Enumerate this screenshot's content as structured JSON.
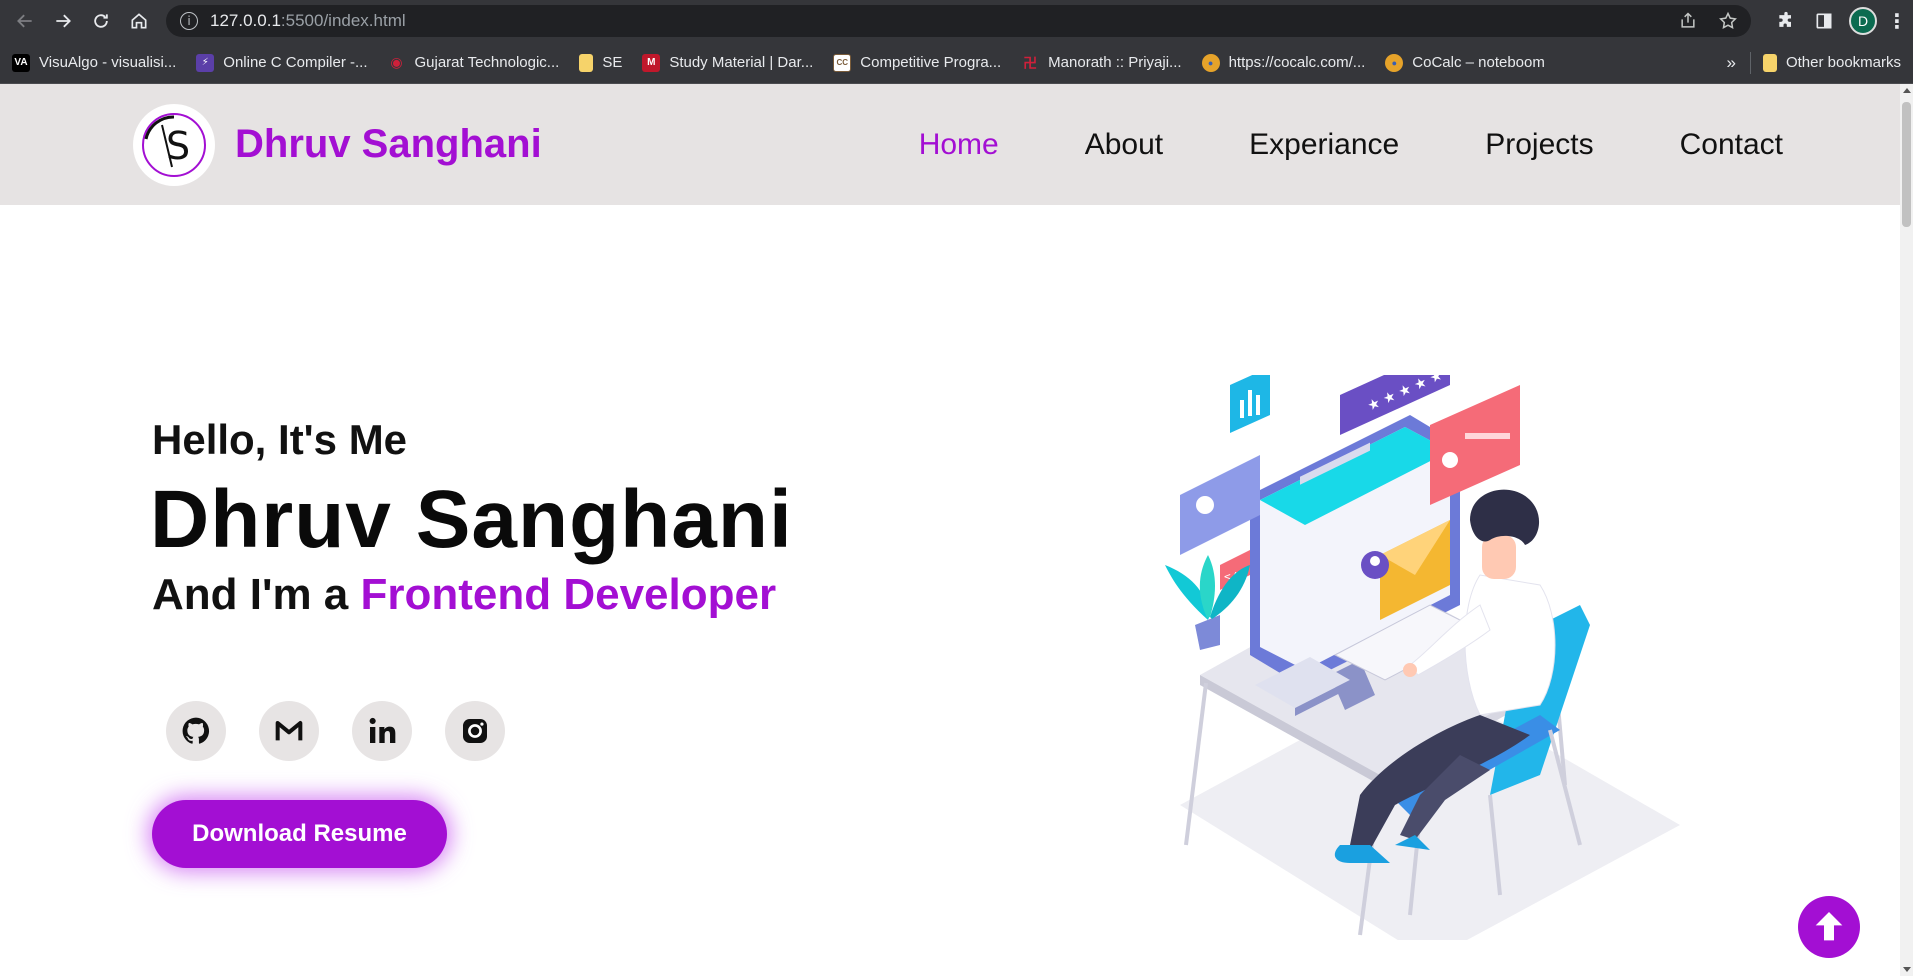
{
  "browser": {
    "url_host": "127.0.0.1",
    "url_path": ":5500/index.html",
    "profile_initial": "D",
    "bookmarks": [
      {
        "label": "VisuAlgo - visualisi...",
        "icon": "visualgo-icon",
        "icon_text": "VA",
        "color": "#000000"
      },
      {
        "label": "Online C Compiler -...",
        "icon": "bolt-icon",
        "icon_text": "⚡",
        "color": "#5b3fa8"
      },
      {
        "label": "Gujarat Technologic...",
        "icon": "gtu-icon",
        "icon_text": "◉",
        "color": "#b02030"
      },
      {
        "label": "SE",
        "icon": "folder-icon",
        "icon_text": "",
        "color": "#f6d36a"
      },
      {
        "label": "Study Material | Dar...",
        "icon": "study-icon",
        "icon_text": "M",
        "color": "#c0182b"
      },
      {
        "label": "Competitive Progra...",
        "icon": "cc-icon",
        "icon_text": "CC",
        "color": "#7a5c3a"
      },
      {
        "label": "Manorath :: Priyaji...",
        "icon": "temple-icon",
        "icon_text": "卍",
        "color": "#b0203a"
      },
      {
        "label": "https://cocalc.com/...",
        "icon": "cocalc-icon",
        "icon_text": "●",
        "color": "#3a5fb0"
      },
      {
        "label": "CoCalc – noteboom",
        "icon": "cocalc-icon",
        "icon_text": "●",
        "color": "#3a5fb0"
      }
    ],
    "more_bookmarks": "»",
    "other_bookmarks": "Other bookmarks"
  },
  "site": {
    "logo_letter": "S",
    "brand": "Dhruv Sanghani",
    "nav": [
      {
        "label": "Home",
        "active": true
      },
      {
        "label": "About",
        "active": false
      },
      {
        "label": "Experiance",
        "active": false
      },
      {
        "label": "Projects",
        "active": false
      },
      {
        "label": "Contact",
        "active": false
      }
    ]
  },
  "hero": {
    "greeting": "Hello, It's Me",
    "name": "Dhruv Sanghani",
    "role_prefix": "And I'm a ",
    "role_accent": "Frontend Developer",
    "socials": [
      {
        "name": "github",
        "icon": "github-icon"
      },
      {
        "name": "gmail",
        "icon": "gmail-icon"
      },
      {
        "name": "linkedin",
        "icon": "linkedin-icon"
      },
      {
        "name": "instagram",
        "icon": "instagram-icon"
      }
    ],
    "button_label": "Download Resume",
    "illustration": "developer-at-desk-illustration"
  },
  "colors": {
    "accent": "#a30fd3",
    "header_bg": "#e6e3e3"
  }
}
